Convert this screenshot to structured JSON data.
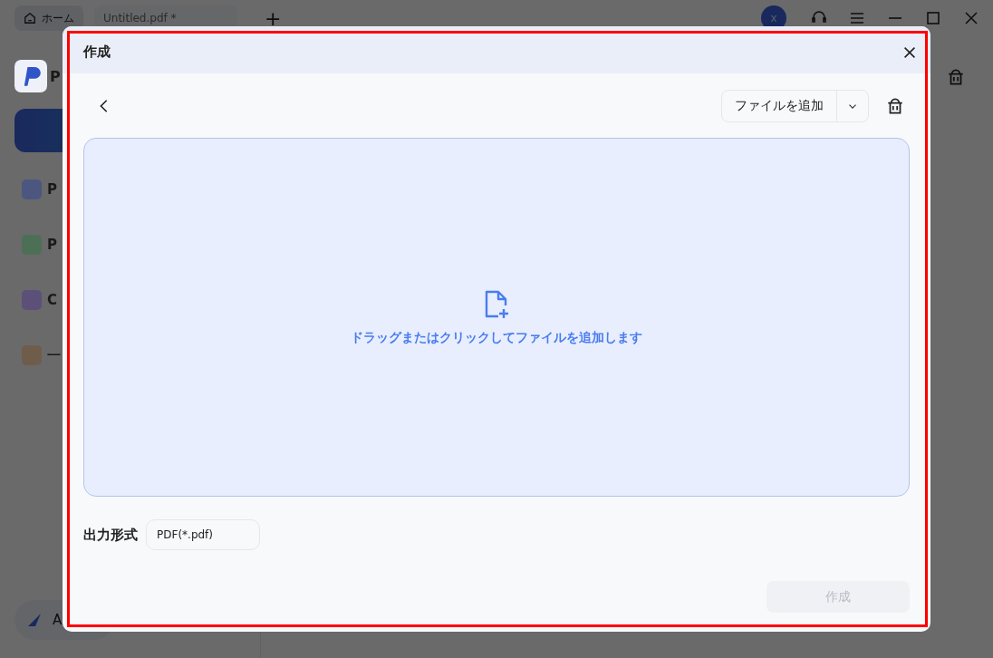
{
  "app": {
    "tabs": [
      {
        "label": "ホーム",
        "selected": true
      },
      {
        "label": "Untitled.pdf *",
        "selected": false
      }
    ],
    "new_tab": "+",
    "avatar": "x",
    "logo_text": "P",
    "sidebar": {
      "items": [
        {
          "label": "P",
          "color": "#4c5780"
        },
        {
          "label": "P",
          "color": "#4d6f55"
        },
        {
          "label": "C",
          "color": "#5d5078"
        },
        {
          "label": "一",
          "color": "#6f5c4a"
        }
      ],
      "bottom": "A"
    }
  },
  "dialog": {
    "title": "作成",
    "add_button": "ファイルを追加",
    "drop_text": "ドラッグまたはクリックしてファイルを追加します",
    "output_label": "出力形式",
    "output_value": "PDF(*.pdf)",
    "create_button": {
      "label": "作成",
      "disabled": true
    }
  }
}
